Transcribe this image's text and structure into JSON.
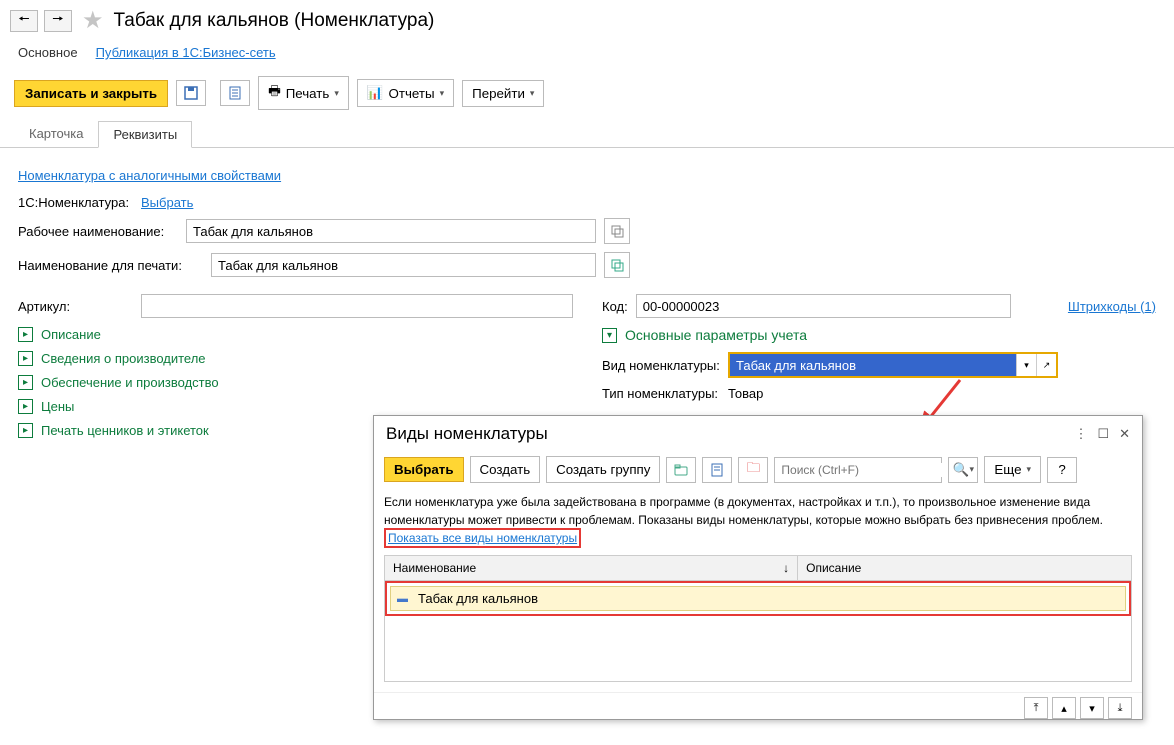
{
  "header": {
    "title": "Табак для кальянов (Номенклатура)"
  },
  "nav": {
    "main": "Основное",
    "pub": "Публикация в 1С:Бизнес-сеть"
  },
  "toolbar": {
    "save_close": "Записать и закрыть",
    "print": "Печать",
    "reports": "Отчеты",
    "goto": "Перейти"
  },
  "tabs": {
    "card": "Карточка",
    "props": "Реквизиты"
  },
  "links": {
    "similar": "Номенклатура с аналогичными свойствами",
    "select": "Выбрать",
    "barcodes": "Штрихкоды (1)",
    "show_all": "Показать все виды номенклатуры"
  },
  "labels": {
    "nom_1c": "1С:Номенклатура:",
    "work_name": "Рабочее наименование:",
    "print_name": "Наименование для печати:",
    "article": "Артикул:",
    "code": "Код:",
    "desc": "Описание",
    "mfr": "Сведения о производителе",
    "supply": "Обеспечение и производство",
    "prices": "Цены",
    "tags": "Печать ценников и этикеток",
    "main_params": "Основные параметры учета",
    "nom_type": "Вид номенклатуры:",
    "type": "Тип номенклатуры:"
  },
  "values": {
    "work_name": "Табак для кальянов",
    "print_name": "Табак для кальянов",
    "article": "",
    "code": "00-00000023",
    "nom_type": "Табак для кальянов",
    "type": "Товар"
  },
  "modal": {
    "title": "Виды номенклатуры",
    "select": "Выбрать",
    "create": "Создать",
    "create_group": "Создать группу",
    "search_ph": "Поиск (Ctrl+F)",
    "more": "Еще",
    "info": "Если номенклатура уже была задействована в программе (в документах, настройках и т.п.), то произвольное изменение вида номенклатуры может привести к проблемам. Показаны виды номенклатуры, которые можно выбрать без привнесения проблем.",
    "col_name": "Наименование",
    "col_desc": "Описание",
    "row1": "Табак для кальянов"
  }
}
